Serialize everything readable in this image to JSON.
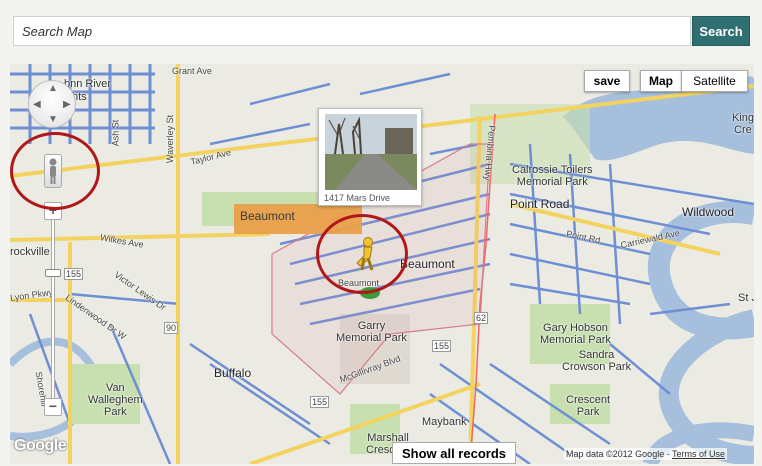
{
  "search": {
    "placeholder": "Search Map",
    "button_label": "Search"
  },
  "map": {
    "save_label": "save",
    "maptype_map": "Map",
    "maptype_satellite": "Satellite",
    "popup_caption": "1417 Mars Drive",
    "selected_area_label": "Beaumont",
    "show_all_label": "Show all records",
    "google_logo": "Google",
    "attribution_text": "Map data ©2012 Google - ",
    "terms_link": "Terms of Use",
    "zoom_in": "+",
    "zoom_out": "−",
    "labels": {
      "bonn_river": "bnn River",
      "hts": "hts",
      "grant_ave": "Grant Ave",
      "waverley_st": "Waverley St",
      "taylor_ave": "Taylor Ave",
      "ash_st": "Ash St",
      "kings": "King",
      "cres": "Cre",
      "calrossie": "Calrossie Toilers\nMemorial Park",
      "point_road": "Point Road",
      "point_rd": "Point Rd",
      "wildwood": "Wildwood",
      "carrierwald": "Carriewald Ave",
      "st_jo": "St Jo",
      "rockville": "rockville",
      "wilkes_ave": "Wilkes Ave",
      "victor_lewis": "Victor Lewis Dr",
      "lindenwood": "Lindenwood Dr W",
      "beaumont": "Beaumont",
      "beaumont_small": "Beaumont",
      "garry": "Garry\nMemorial Park",
      "gary_hobson": "Gary Hobson\nMemorial Park",
      "sandra": "Sandra\nCrowson Park",
      "buffalo": "Buffalo",
      "van_walleghem": "Van\nWalleghem\nPark",
      "crescent_park": "Crescent\nPark",
      "maybank": "Maybank",
      "marshall": "Marshall\nCrescent",
      "mcgillivray": "McGillivray Blvd",
      "pembina": "Pembina Hwy",
      "shore": "Shorehill",
      "route_155": "155",
      "route_90": "90",
      "route_62": "62",
      "lyon": "Lyon Pkwy"
    }
  },
  "colors": {
    "accent": "#2f6e71",
    "road": "#6f8fd3",
    "road_major": "#f3d360",
    "park": "#c8e0b0",
    "water": "#a5bfdd",
    "highlight": "#b01818"
  }
}
